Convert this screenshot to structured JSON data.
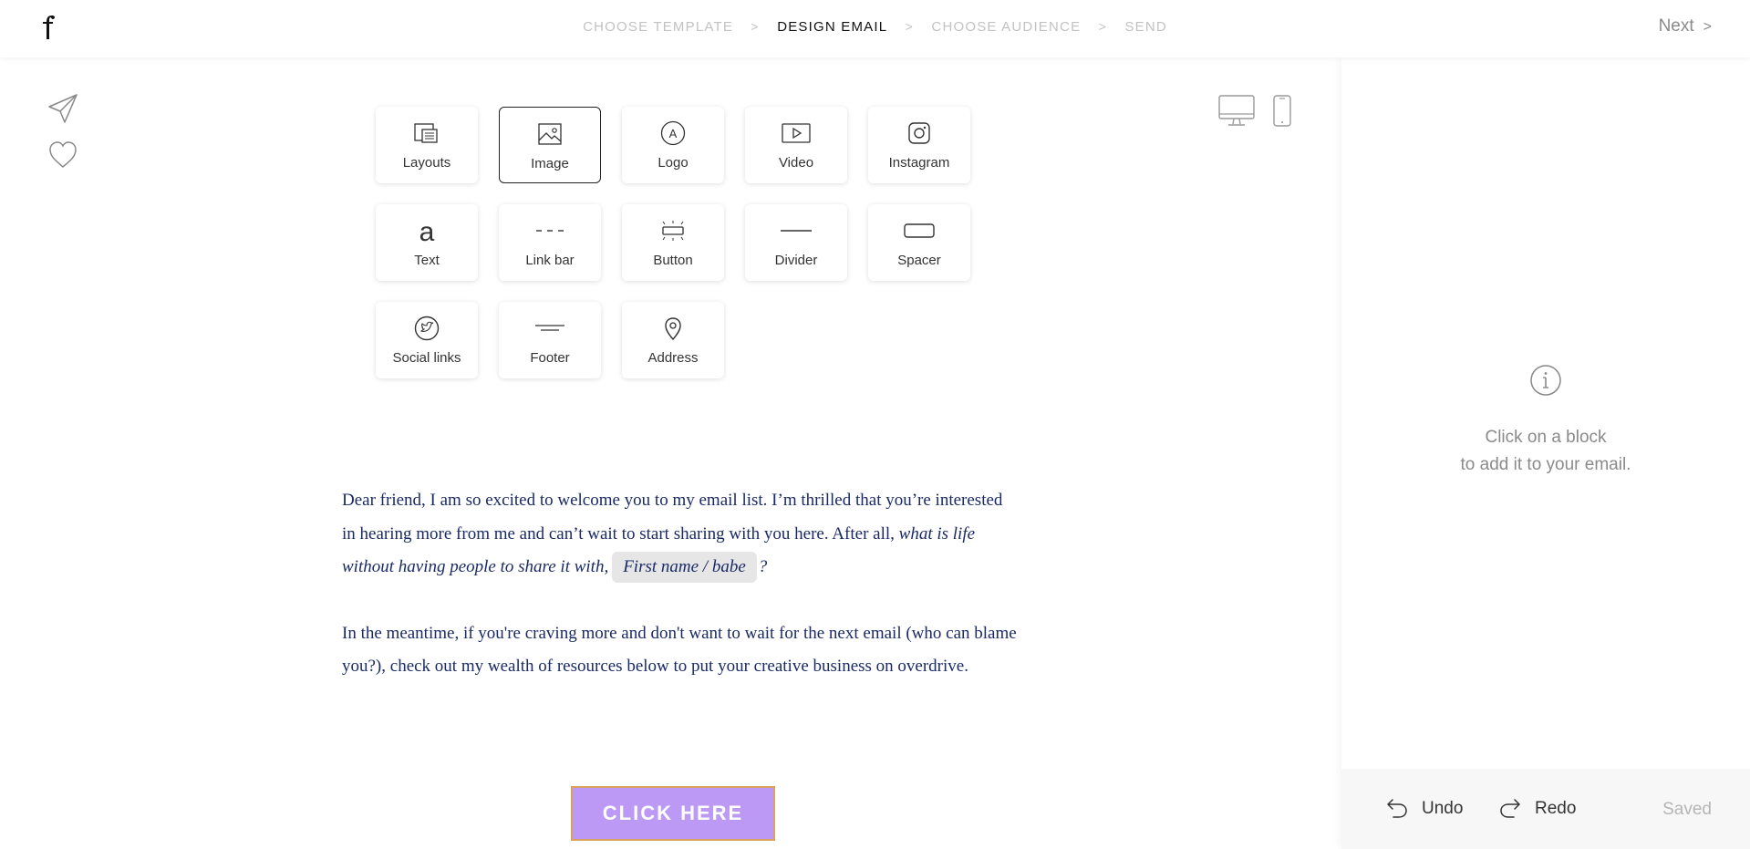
{
  "header": {
    "steps": [
      {
        "label": "CHOOSE TEMPLATE",
        "state": "done"
      },
      {
        "label": "DESIGN EMAIL",
        "state": "active"
      },
      {
        "label": "CHOOSE AUDIENCE",
        "state": "pending"
      },
      {
        "label": "SEND",
        "state": "pending"
      }
    ],
    "separator": ">",
    "next_label": "Next",
    "next_chevron": ">"
  },
  "blocks": [
    {
      "label": "Layouts",
      "icon": "layouts-icon",
      "selected": false
    },
    {
      "label": "Image",
      "icon": "image-icon",
      "selected": true
    },
    {
      "label": "Logo",
      "icon": "logo-icon",
      "selected": false
    },
    {
      "label": "Video",
      "icon": "video-icon",
      "selected": false
    },
    {
      "label": "Instagram",
      "icon": "instagram-icon",
      "selected": false
    },
    {
      "label": "Text",
      "icon": "text-icon",
      "selected": false
    },
    {
      "label": "Link bar",
      "icon": "link-bar-icon",
      "selected": false
    },
    {
      "label": "Button",
      "icon": "button-icon",
      "selected": false
    },
    {
      "label": "Divider",
      "icon": "divider-icon",
      "selected": false
    },
    {
      "label": "Spacer",
      "icon": "spacer-icon",
      "selected": false
    },
    {
      "label": "Social links",
      "icon": "social-links-icon",
      "selected": false
    },
    {
      "label": "Footer",
      "icon": "footer-icon",
      "selected": false
    },
    {
      "label": "Address",
      "icon": "address-icon",
      "selected": false
    }
  ],
  "email": {
    "para1_lead": "Dear friend, I am so excited to welcome you to my email list. I’m thrilled that you’re interested in hearing more from me and can’t wait to start sharing with you here. After all,",
    "para1_italic": "what is life without having people to share it with,",
    "merge_tag": "First name / babe",
    "para1_end": "?",
    "para2": "In the meantime, if you're craving more and don't want to wait for the next email (who can blame you?), check out my wealth of resources below to put your creative business on overdrive.",
    "button_label": "CLICK HERE"
  },
  "panel": {
    "message_line1": "Click on a block",
    "message_line2": "to add it to your email.",
    "undo_label": "Undo",
    "redo_label": "Redo",
    "saved_label": "Saved"
  },
  "colors": {
    "email_text": "#1a2a66",
    "button_bg": "#bb99f5",
    "button_border": "#d8a25c",
    "active_step": "#111111",
    "inactive_step": "#c2c2c2"
  }
}
